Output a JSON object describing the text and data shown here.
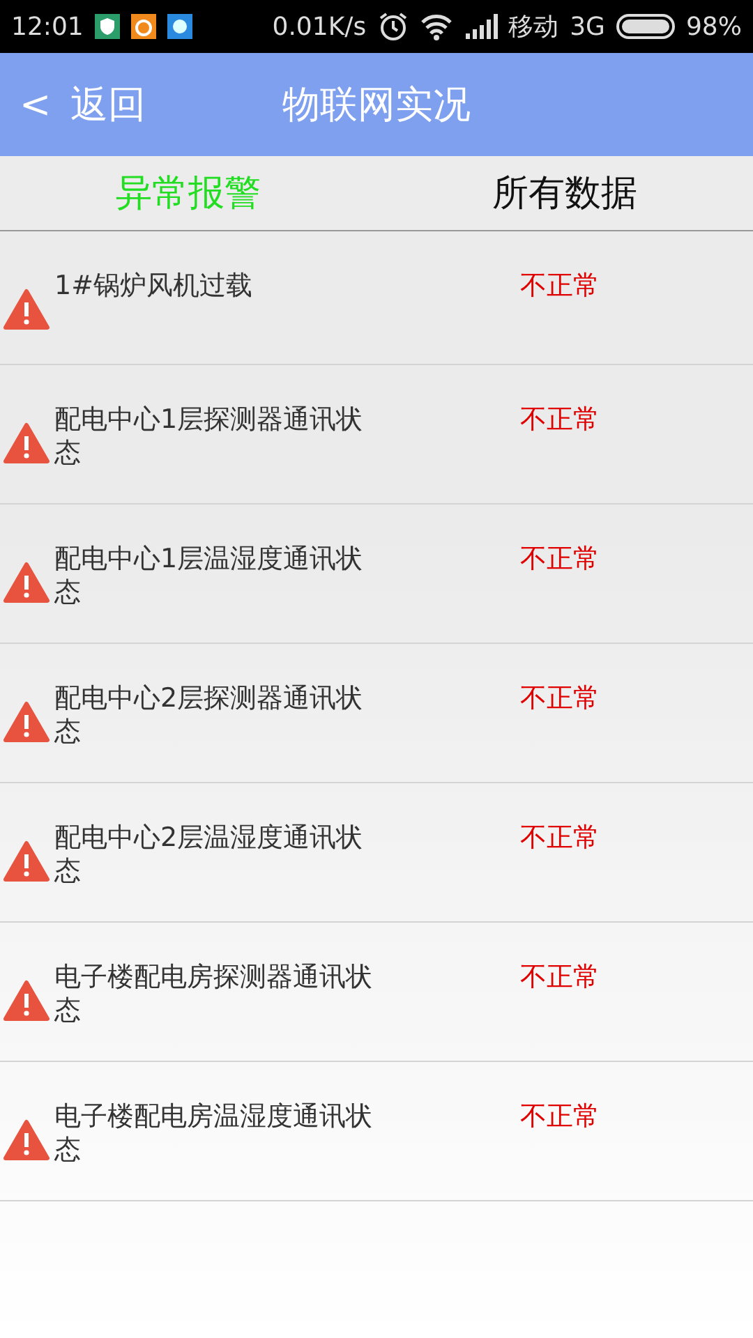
{
  "status_bar": {
    "time": "12:01",
    "speed": "0.01K/s",
    "carrier": "移动",
    "network": "3G",
    "battery": "98%"
  },
  "header": {
    "back_arrow": "<",
    "back": "返回",
    "title": "物联网实况"
  },
  "tabs": [
    {
      "label": "异常报警",
      "selected": true
    },
    {
      "label": "所有数据",
      "selected": false
    }
  ],
  "alarms": [
    {
      "name": "1#锅炉风机过载",
      "status": "不正常"
    },
    {
      "name": "配电中心1层探测器通讯状态",
      "status": "不正常"
    },
    {
      "name": "配电中心1层温湿度通讯状态",
      "status": "不正常"
    },
    {
      "name": "配电中心2层探测器通讯状态",
      "status": "不正常"
    },
    {
      "name": "配电中心2层温湿度通讯状态",
      "status": "不正常"
    },
    {
      "name": "电子楼配电房探测器通讯状态",
      "status": "不正常"
    },
    {
      "name": "电子楼配电房温湿度通讯状态",
      "status": "不正常"
    }
  ]
}
